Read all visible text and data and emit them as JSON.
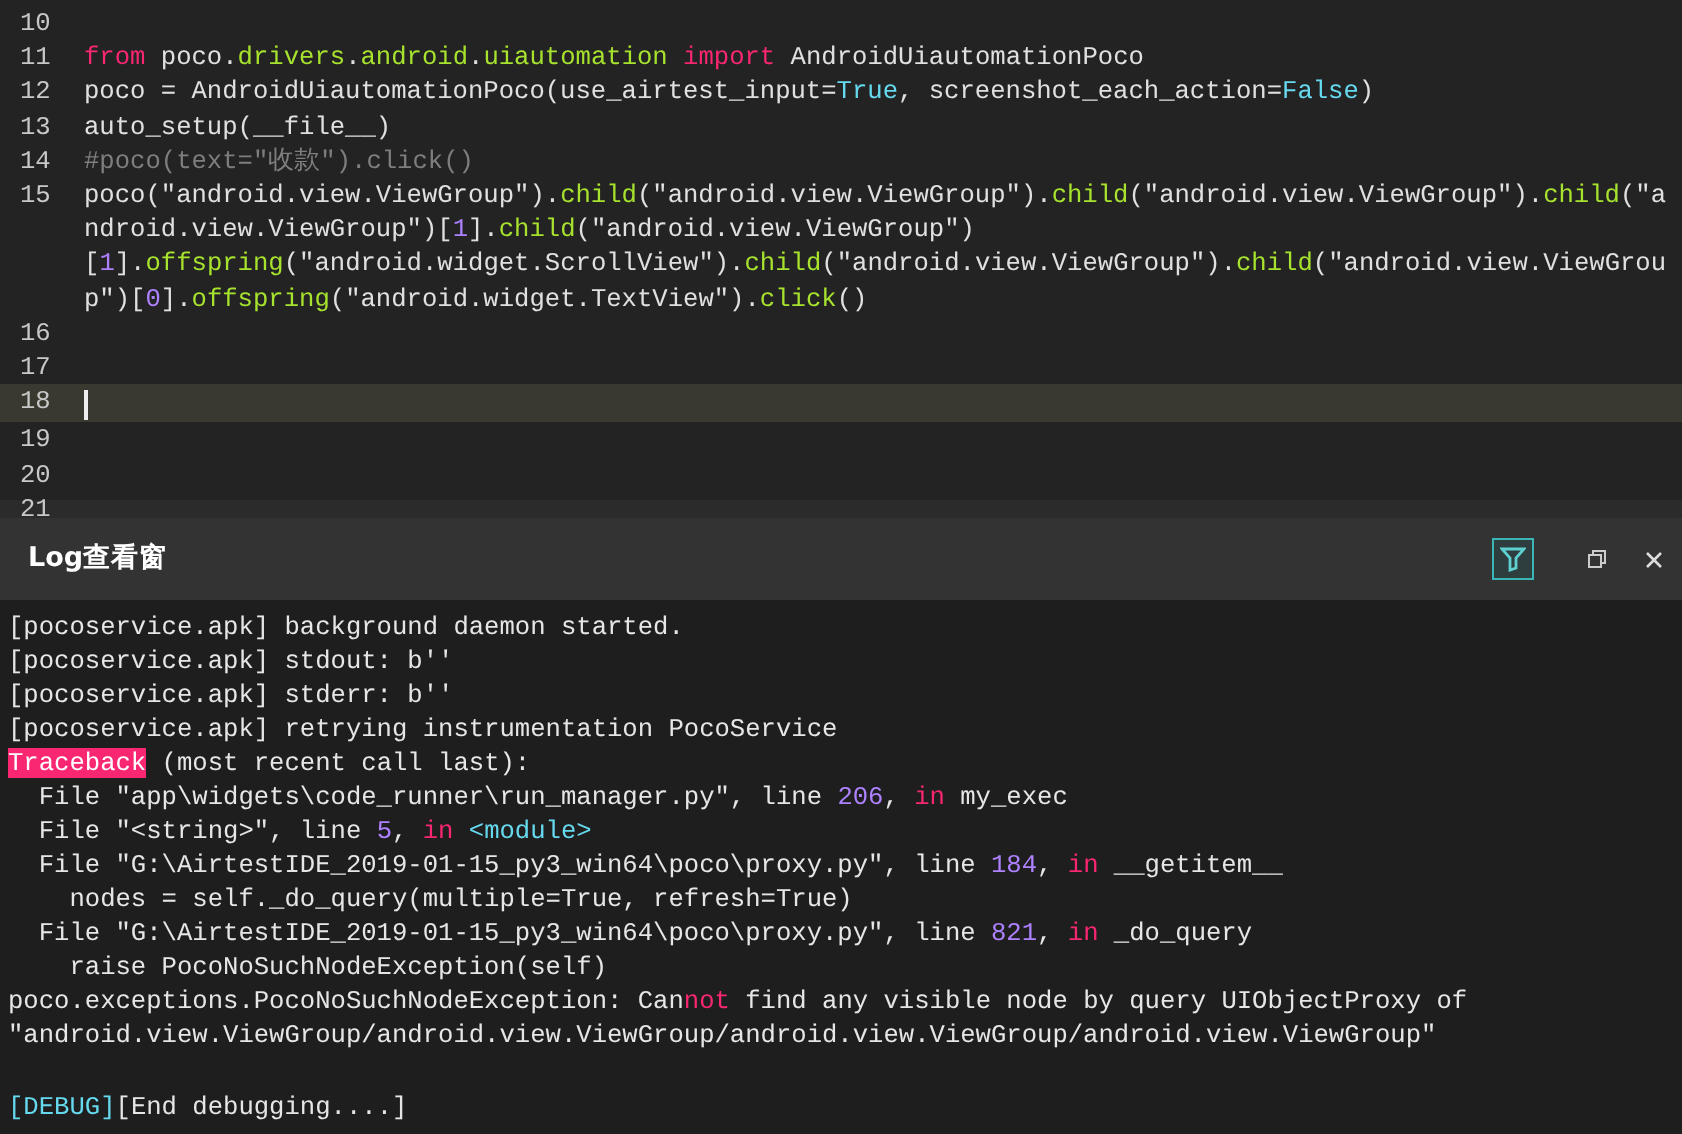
{
  "editor": {
    "lines": [
      {
        "number": "10",
        "current": false
      },
      {
        "number": "11",
        "current": false,
        "rows": [
          {
            "segments": [
              {
                "kind": "keyword",
                "text": "from"
              },
              {
                "kind": "plain",
                "text": " poco."
              },
              {
                "kind": "module",
                "text": "drivers"
              },
              {
                "kind": "plain",
                "text": "."
              },
              {
                "kind": "module",
                "text": "android"
              },
              {
                "kind": "plain",
                "text": "."
              },
              {
                "kind": "module",
                "text": "uiautomation"
              },
              {
                "kind": "keyword",
                "text": " import"
              },
              {
                "kind": "plain",
                "text": " AndroidUiautomationPoco"
              }
            ]
          }
        ]
      },
      {
        "number": "12",
        "current": false,
        "rows": [
          {
            "segments": [
              {
                "kind": "plain",
                "text": "poco = AndroidUiautomationPoco(use_airtest_input="
              },
              {
                "kind": "constant",
                "text": "True"
              },
              {
                "kind": "plain",
                "text": ", screenshot_each_action="
              },
              {
                "kind": "constant",
                "text": "False"
              },
              {
                "kind": "plain",
                "text": ")"
              }
            ]
          }
        ]
      },
      {
        "number": "13",
        "current": false,
        "rows": [
          {
            "segments": [
              {
                "kind": "plain",
                "text": "auto_setup(__file__)"
              }
            ]
          }
        ]
      },
      {
        "number": "14",
        "current": false,
        "rows": [
          {
            "segments": [
              {
                "kind": "comment",
                "text": "#poco(text=\"收款\").click()"
              }
            ]
          }
        ]
      },
      {
        "number": "15",
        "current": false,
        "rows": [
          {
            "segments": [
              {
                "kind": "plain",
                "text": "poco(\"android.view.ViewGroup\")."
              },
              {
                "kind": "module",
                "text": "child"
              },
              {
                "kind": "plain",
                "text": "(\"android.view.ViewGroup\")."
              },
              {
                "kind": "module",
                "text": "child"
              },
              {
                "kind": "plain",
                "text": "(\"android.view.ViewGroup\")."
              },
              {
                "kind": "module",
                "text": "child"
              },
              {
                "kind": "plain",
                "text": "(\"a"
              }
            ]
          },
          {
            "segments": [
              {
                "kind": "plain",
                "text": "ndroid.view.ViewGroup\")["
              },
              {
                "kind": "number",
                "text": "1"
              },
              {
                "kind": "plain",
                "text": "]."
              },
              {
                "kind": "module",
                "text": "child"
              },
              {
                "kind": "plain",
                "text": "(\"android.view.ViewGroup\")"
              }
            ]
          },
          {
            "segments": [
              {
                "kind": "plain",
                "text": "["
              },
              {
                "kind": "number",
                "text": "1"
              },
              {
                "kind": "plain",
                "text": "]."
              },
              {
                "kind": "module",
                "text": "offspring"
              },
              {
                "kind": "plain",
                "text": "(\"android.widget.ScrollView\")."
              },
              {
                "kind": "module",
                "text": "child"
              },
              {
                "kind": "plain",
                "text": "(\"android.view.ViewGroup\")."
              },
              {
                "kind": "module",
                "text": "child"
              },
              {
                "kind": "plain",
                "text": "(\"android.view.ViewGrou"
              }
            ]
          },
          {
            "segments": [
              {
                "kind": "plain",
                "text": "p\")["
              },
              {
                "kind": "number",
                "text": "0"
              },
              {
                "kind": "plain",
                "text": "]."
              },
              {
                "kind": "module",
                "text": "offspring"
              },
              {
                "kind": "plain",
                "text": "(\"android.widget.TextView\")."
              },
              {
                "kind": "module",
                "text": "click"
              },
              {
                "kind": "plain",
                "text": "()"
              }
            ]
          }
        ]
      },
      {
        "number": "16",
        "current": false
      },
      {
        "number": "17",
        "current": false
      },
      {
        "number": "18",
        "current": true
      },
      {
        "number": "19",
        "current": false
      },
      {
        "number": "20",
        "current": false
      },
      {
        "number": "21",
        "current": false
      }
    ]
  },
  "log_panel": {
    "title": "Log查看窗",
    "filter_on": true,
    "lines": [
      {
        "segments": [
          {
            "kind": "plain",
            "text": "[pocoservice.apk] background daemon started."
          }
        ]
      },
      {
        "segments": [
          {
            "kind": "plain",
            "text": "[pocoservice.apk] stdout: b''"
          }
        ]
      },
      {
        "segments": [
          {
            "kind": "plain",
            "text": "[pocoservice.apk] stderr: b''"
          }
        ]
      },
      {
        "segments": [
          {
            "kind": "plain",
            "text": "[pocoservice.apk] retrying instrumentation PocoService"
          }
        ]
      },
      {
        "segments": [
          {
            "kind": "highlight",
            "text": "Traceback"
          },
          {
            "kind": "plain",
            "text": " (most recent call last):"
          }
        ]
      },
      {
        "segments": [
          {
            "kind": "plain",
            "text": "  File \"app\\widgets\\code_runner\\run_manager.py\", line "
          },
          {
            "kind": "number",
            "text": "206"
          },
          {
            "kind": "plain",
            "text": ", "
          },
          {
            "kind": "keyword",
            "text": "in"
          },
          {
            "kind": "plain",
            "text": " my_exec"
          }
        ]
      },
      {
        "segments": [
          {
            "kind": "plain",
            "text": "  File \"<string>\", line "
          },
          {
            "kind": "number",
            "text": "5"
          },
          {
            "kind": "plain",
            "text": ", "
          },
          {
            "kind": "keyword",
            "text": "in"
          },
          {
            "kind": "constant",
            "text": " <module>"
          }
        ]
      },
      {
        "segments": [
          {
            "kind": "plain",
            "text": "  File \"G:\\AirtestIDE_2019-01-15_py3_win64\\poco\\proxy.py\", line "
          },
          {
            "kind": "number",
            "text": "184"
          },
          {
            "kind": "plain",
            "text": ", "
          },
          {
            "kind": "keyword",
            "text": "in"
          },
          {
            "kind": "plain",
            "text": " __getitem__"
          }
        ]
      },
      {
        "segments": [
          {
            "kind": "plain",
            "text": "    nodes = self._do_query(multiple=True, refresh=True)"
          }
        ]
      },
      {
        "segments": [
          {
            "kind": "plain",
            "text": "  File \"G:\\AirtestIDE_2019-01-15_py3_win64\\poco\\proxy.py\", line "
          },
          {
            "kind": "number",
            "text": "821"
          },
          {
            "kind": "plain",
            "text": ", "
          },
          {
            "kind": "keyword",
            "text": "in"
          },
          {
            "kind": "plain",
            "text": " _do_query"
          }
        ]
      },
      {
        "segments": [
          {
            "kind": "plain",
            "text": "    raise PocoNoSuchNodeException(self)"
          }
        ]
      },
      {
        "segments": [
          {
            "kind": "plain",
            "text": "poco.exceptions.PocoNoSuchNodeException: Can"
          },
          {
            "kind": "keyword",
            "text": "not"
          },
          {
            "kind": "plain",
            "text": " find any visible node by query UIObjectProxy of"
          }
        ]
      },
      {
        "segments": [
          {
            "kind": "plain",
            "text": "\"android.view.ViewGroup/android.view.ViewGroup/android.view.ViewGroup/android.view.ViewGroup\""
          }
        ]
      }
    ],
    "last_line": {
      "segments": [
        {
          "kind": "constant",
          "text": "[DEBUG]"
        },
        {
          "kind": "plain",
          "text": "[End debugging....]"
        }
      ]
    }
  }
}
